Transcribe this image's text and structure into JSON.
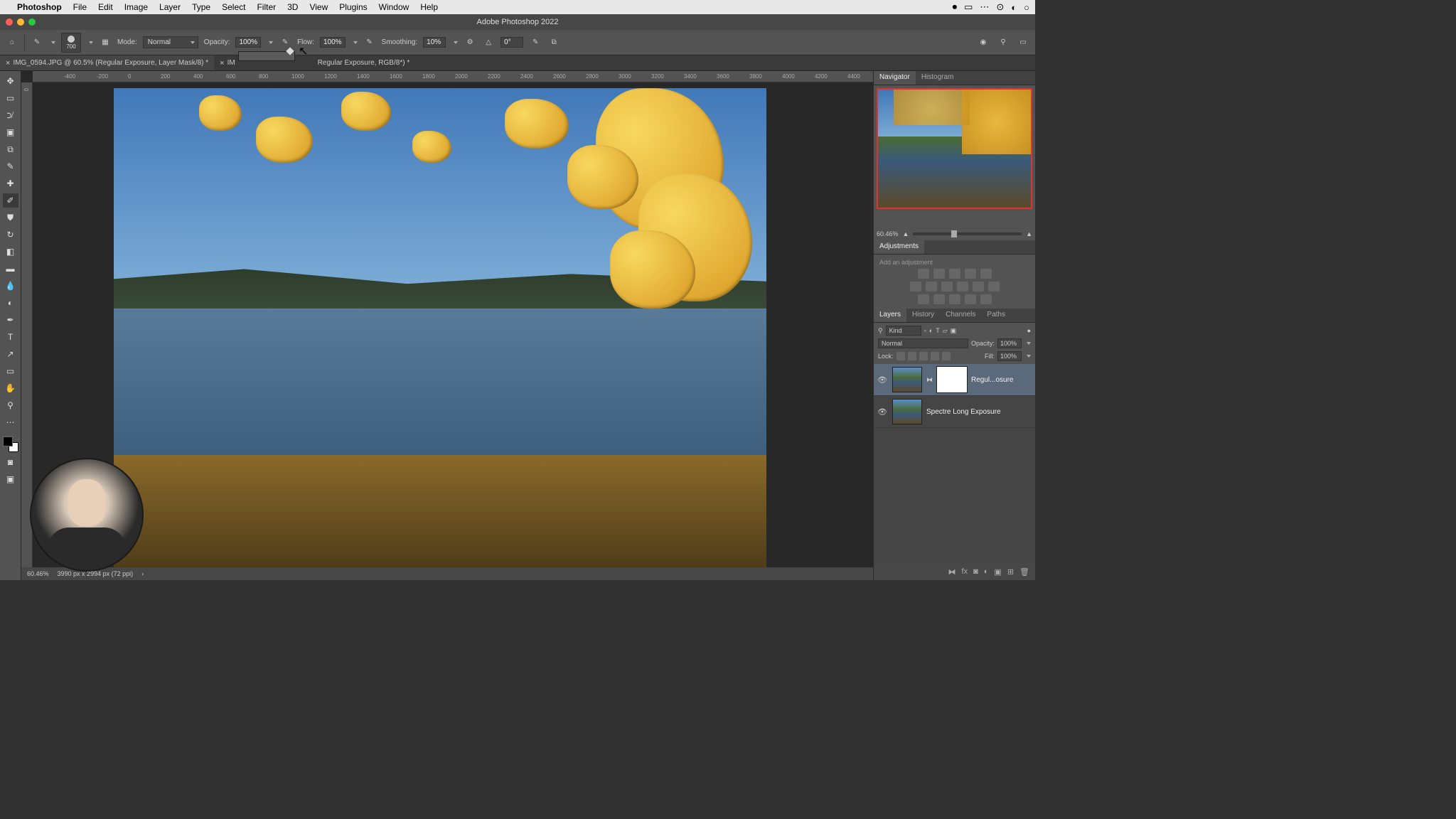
{
  "menu": {
    "app": "Photoshop",
    "items": [
      "File",
      "Edit",
      "Image",
      "Layer",
      "Type",
      "Select",
      "Filter",
      "3D",
      "View",
      "Plugins",
      "Window",
      "Help"
    ]
  },
  "titlebar": "Adobe Photoshop 2022",
  "options": {
    "brush_size": "700",
    "mode_label": "Mode:",
    "mode": "Normal",
    "opacity_label": "Opacity:",
    "opacity": "100%",
    "flow_label": "Flow:",
    "flow": "100%",
    "smoothing_label": "Smoothing:",
    "smoothing": "10%",
    "angle_label": "",
    "angle": "0°"
  },
  "tabs": [
    {
      "name": "IMG_0594.JPG @ 60.5% (Regular Exposure, Layer Mask/8) *",
      "active": true
    },
    {
      "name": "IM",
      "active": false
    },
    {
      "name_suffix": "Regular Exposure, RGB/8*) *"
    }
  ],
  "ruler_h": [
    "-400",
    "-200",
    "0",
    "200",
    "400",
    "600",
    "800",
    "1000",
    "1200",
    "1400",
    "1600",
    "1800",
    "2000",
    "2200",
    "2400",
    "2600",
    "2800",
    "3000",
    "3200",
    "3400",
    "3600",
    "3800",
    "4000",
    "4200",
    "4400"
  ],
  "ruler_v": "0",
  "navigator": {
    "tab1": "Navigator",
    "tab2": "Histogram",
    "zoom": "60.46%"
  },
  "adjustments": {
    "title": "Adjustments",
    "hint": "Add an adjustment"
  },
  "layers_panel": {
    "tabs": [
      "Layers",
      "History",
      "Channels",
      "Paths"
    ],
    "filter": "Kind",
    "blend": "Normal",
    "opacity_label": "Opacity:",
    "opacity": "100%",
    "lock_label": "Lock:",
    "fill_label": "Fill:",
    "fill": "100%",
    "layers": [
      {
        "name": "Regul...osure",
        "has_mask": true,
        "selected": true
      },
      {
        "name": "Spectre Long Exposure",
        "has_mask": false,
        "selected": false
      }
    ]
  },
  "status": {
    "zoom": "60.46%",
    "info": "3990 px x 2994 px (72 ppi)"
  }
}
